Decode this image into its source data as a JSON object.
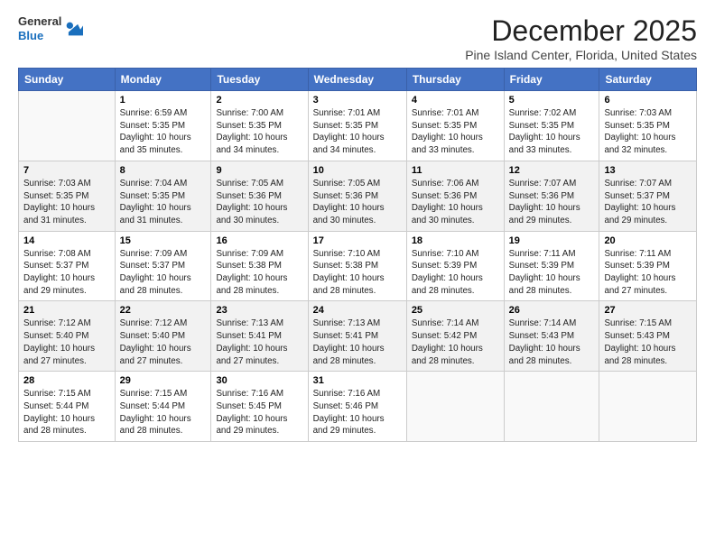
{
  "logo": {
    "general": "General",
    "blue": "Blue"
  },
  "header": {
    "month_year": "December 2025",
    "location": "Pine Island Center, Florida, United States"
  },
  "weekdays": [
    "Sunday",
    "Monday",
    "Tuesday",
    "Wednesday",
    "Thursday",
    "Friday",
    "Saturday"
  ],
  "weeks": [
    [
      {
        "day": "",
        "info": ""
      },
      {
        "day": "1",
        "info": "Sunrise: 6:59 AM\nSunset: 5:35 PM\nDaylight: 10 hours\nand 35 minutes."
      },
      {
        "day": "2",
        "info": "Sunrise: 7:00 AM\nSunset: 5:35 PM\nDaylight: 10 hours\nand 34 minutes."
      },
      {
        "day": "3",
        "info": "Sunrise: 7:01 AM\nSunset: 5:35 PM\nDaylight: 10 hours\nand 34 minutes."
      },
      {
        "day": "4",
        "info": "Sunrise: 7:01 AM\nSunset: 5:35 PM\nDaylight: 10 hours\nand 33 minutes."
      },
      {
        "day": "5",
        "info": "Sunrise: 7:02 AM\nSunset: 5:35 PM\nDaylight: 10 hours\nand 33 minutes."
      },
      {
        "day": "6",
        "info": "Sunrise: 7:03 AM\nSunset: 5:35 PM\nDaylight: 10 hours\nand 32 minutes."
      }
    ],
    [
      {
        "day": "7",
        "info": "Sunrise: 7:03 AM\nSunset: 5:35 PM\nDaylight: 10 hours\nand 31 minutes."
      },
      {
        "day": "8",
        "info": "Sunrise: 7:04 AM\nSunset: 5:35 PM\nDaylight: 10 hours\nand 31 minutes."
      },
      {
        "day": "9",
        "info": "Sunrise: 7:05 AM\nSunset: 5:36 PM\nDaylight: 10 hours\nand 30 minutes."
      },
      {
        "day": "10",
        "info": "Sunrise: 7:05 AM\nSunset: 5:36 PM\nDaylight: 10 hours\nand 30 minutes."
      },
      {
        "day": "11",
        "info": "Sunrise: 7:06 AM\nSunset: 5:36 PM\nDaylight: 10 hours\nand 30 minutes."
      },
      {
        "day": "12",
        "info": "Sunrise: 7:07 AM\nSunset: 5:36 PM\nDaylight: 10 hours\nand 29 minutes."
      },
      {
        "day": "13",
        "info": "Sunrise: 7:07 AM\nSunset: 5:37 PM\nDaylight: 10 hours\nand 29 minutes."
      }
    ],
    [
      {
        "day": "14",
        "info": "Sunrise: 7:08 AM\nSunset: 5:37 PM\nDaylight: 10 hours\nand 29 minutes."
      },
      {
        "day": "15",
        "info": "Sunrise: 7:09 AM\nSunset: 5:37 PM\nDaylight: 10 hours\nand 28 minutes."
      },
      {
        "day": "16",
        "info": "Sunrise: 7:09 AM\nSunset: 5:38 PM\nDaylight: 10 hours\nand 28 minutes."
      },
      {
        "day": "17",
        "info": "Sunrise: 7:10 AM\nSunset: 5:38 PM\nDaylight: 10 hours\nand 28 minutes."
      },
      {
        "day": "18",
        "info": "Sunrise: 7:10 AM\nSunset: 5:39 PM\nDaylight: 10 hours\nand 28 minutes."
      },
      {
        "day": "19",
        "info": "Sunrise: 7:11 AM\nSunset: 5:39 PM\nDaylight: 10 hours\nand 28 minutes."
      },
      {
        "day": "20",
        "info": "Sunrise: 7:11 AM\nSunset: 5:39 PM\nDaylight: 10 hours\nand 27 minutes."
      }
    ],
    [
      {
        "day": "21",
        "info": "Sunrise: 7:12 AM\nSunset: 5:40 PM\nDaylight: 10 hours\nand 27 minutes."
      },
      {
        "day": "22",
        "info": "Sunrise: 7:12 AM\nSunset: 5:40 PM\nDaylight: 10 hours\nand 27 minutes."
      },
      {
        "day": "23",
        "info": "Sunrise: 7:13 AM\nSunset: 5:41 PM\nDaylight: 10 hours\nand 27 minutes."
      },
      {
        "day": "24",
        "info": "Sunrise: 7:13 AM\nSunset: 5:41 PM\nDaylight: 10 hours\nand 28 minutes."
      },
      {
        "day": "25",
        "info": "Sunrise: 7:14 AM\nSunset: 5:42 PM\nDaylight: 10 hours\nand 28 minutes."
      },
      {
        "day": "26",
        "info": "Sunrise: 7:14 AM\nSunset: 5:43 PM\nDaylight: 10 hours\nand 28 minutes."
      },
      {
        "day": "27",
        "info": "Sunrise: 7:15 AM\nSunset: 5:43 PM\nDaylight: 10 hours\nand 28 minutes."
      }
    ],
    [
      {
        "day": "28",
        "info": "Sunrise: 7:15 AM\nSunset: 5:44 PM\nDaylight: 10 hours\nand 28 minutes."
      },
      {
        "day": "29",
        "info": "Sunrise: 7:15 AM\nSunset: 5:44 PM\nDaylight: 10 hours\nand 28 minutes."
      },
      {
        "day": "30",
        "info": "Sunrise: 7:16 AM\nSunset: 5:45 PM\nDaylight: 10 hours\nand 29 minutes."
      },
      {
        "day": "31",
        "info": "Sunrise: 7:16 AM\nSunset: 5:46 PM\nDaylight: 10 hours\nand 29 minutes."
      },
      {
        "day": "",
        "info": ""
      },
      {
        "day": "",
        "info": ""
      },
      {
        "day": "",
        "info": ""
      }
    ]
  ]
}
